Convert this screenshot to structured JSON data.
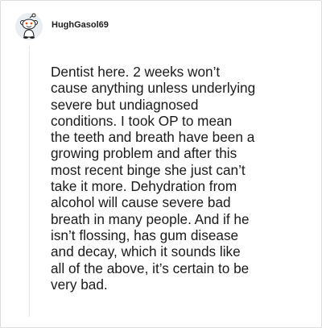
{
  "comment": {
    "author": "HughGasol69",
    "avatar_icon": "reddit-snoo-avatar-icon",
    "body": "Dentist here. 2 weeks won’t\ncause anything unless underlying\nsevere but undiagnosed\nconditions. I took OP to mean\nthe teeth and breath have been a\ngrowing problem and after this\nmost recent binge she just can’t\ntake it more. Dehydration from\nalcohol will cause severe bad\nbreath in many people. And if he\nisn’t flossing, has gum disease\nand decay, which it sounds like\nall of the above, it’s certain to be\nvery bad."
  }
}
